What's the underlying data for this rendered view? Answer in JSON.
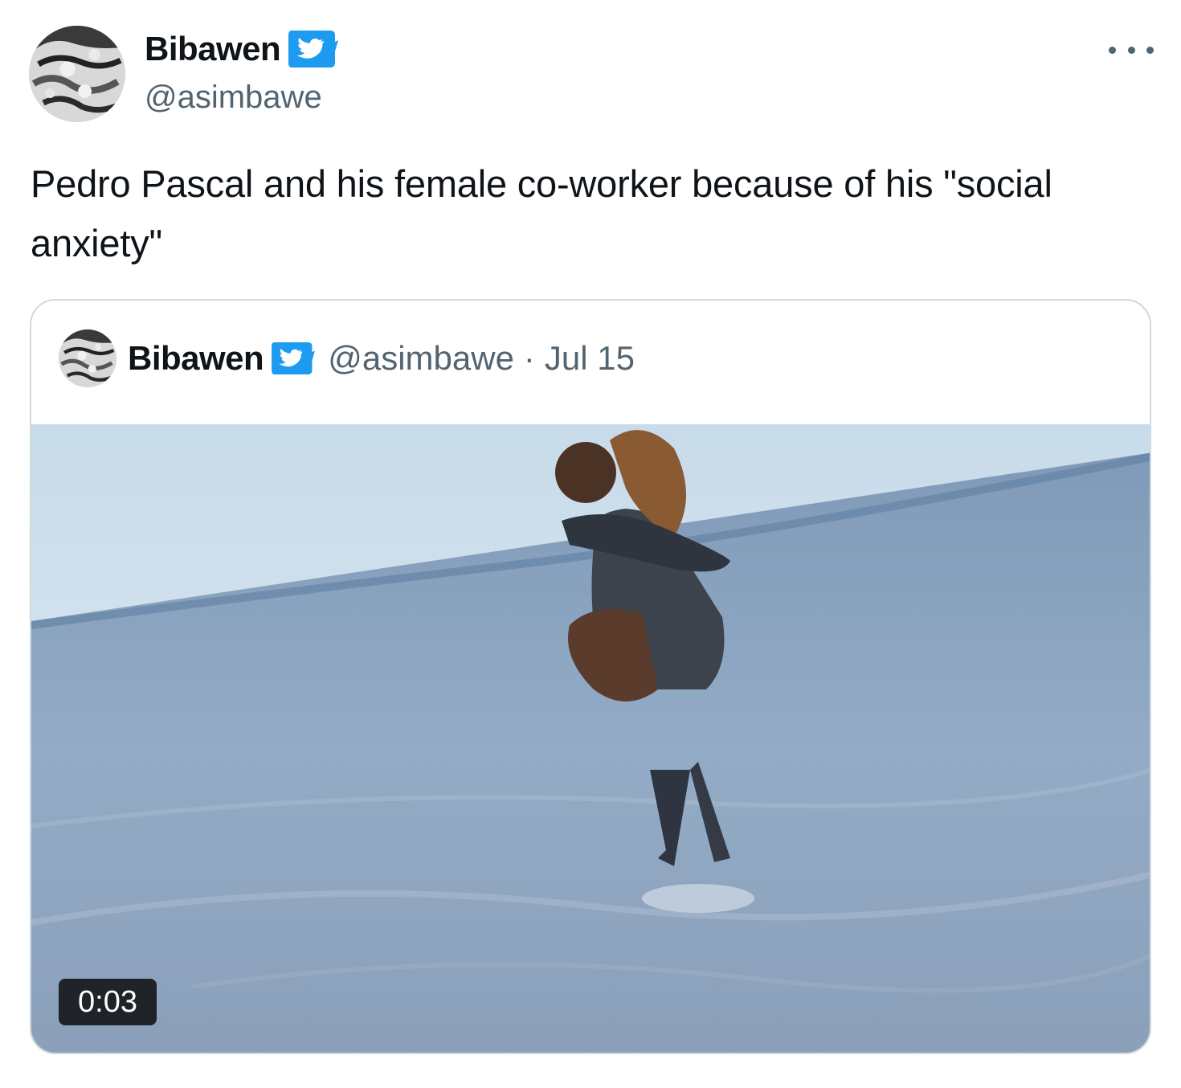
{
  "tweet": {
    "display_name": "Bibawen",
    "handle": "@asimbawe",
    "text": "Pedro Pascal and his female co-worker because of his \"social anxiety\"",
    "more_icon": "ellipsis-icon",
    "verified_icon": "twitter-bird-badge-icon"
  },
  "quoted_tweet": {
    "display_name": "Bibawen",
    "handle": "@asimbawe",
    "separator": "·",
    "date": "Jul 15",
    "media": {
      "type": "video",
      "duration": "0:03"
    }
  },
  "colors": {
    "text_primary": "#0f1419",
    "text_secondary": "#536471",
    "verified_blue": "#1d9bf0",
    "border": "#cfd9de"
  }
}
